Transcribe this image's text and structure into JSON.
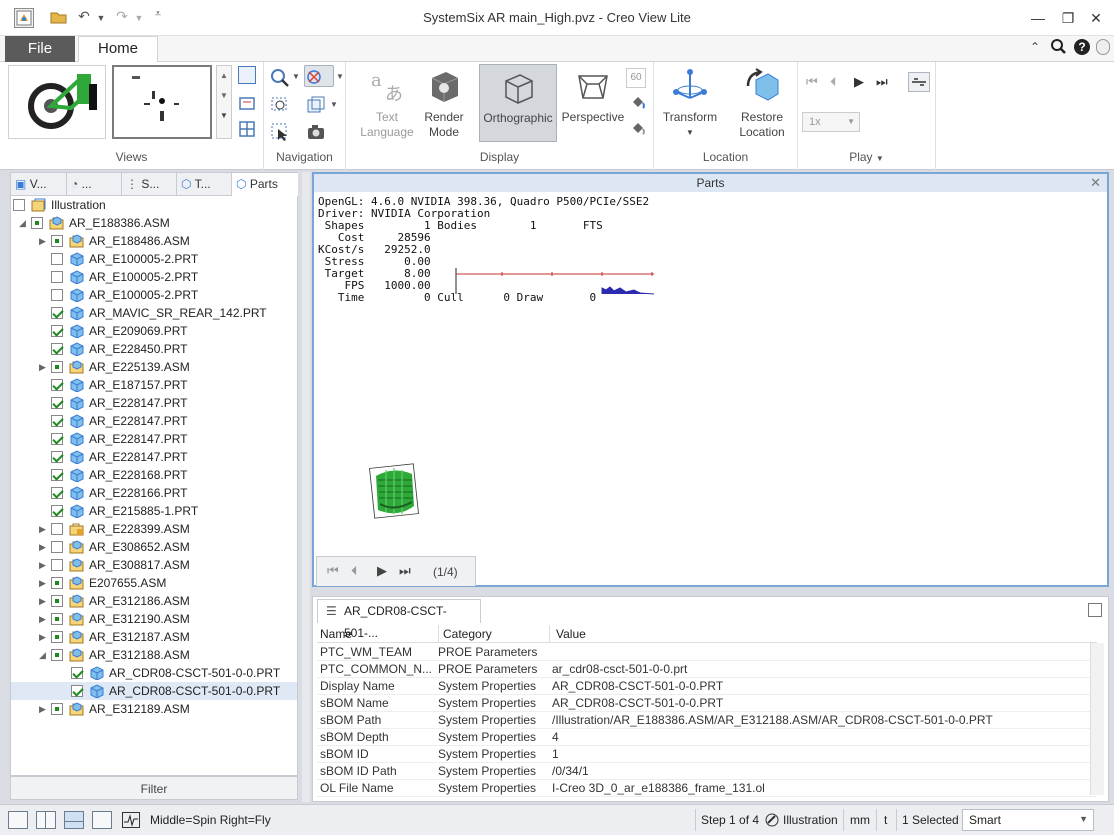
{
  "window": {
    "title": "SystemSix AR main_High.pvz - Creo View Lite"
  },
  "menu": {
    "file": "File",
    "home": "Home"
  },
  "ribbon": {
    "groups": {
      "views": "Views",
      "navigation": "Navigation",
      "display": "Display",
      "location": "Location",
      "play": "Play"
    },
    "text_language": [
      "Text",
      "Language"
    ],
    "render_mode": [
      "Render",
      "Mode"
    ],
    "orthographic": "Orthographic",
    "perspective": "Perspective",
    "fps_box": "60",
    "transform": "Transform",
    "restore_location": [
      "Restore",
      "Location"
    ],
    "speed": "1x"
  },
  "left_tabs": [
    "V...",
    "...",
    "S...",
    "T...",
    "Parts"
  ],
  "tree": [
    {
      "label": "Illustration",
      "level": 0,
      "exp": "",
      "chk": "",
      "icon": "illustration"
    },
    {
      "label": "AR_E188386.ASM",
      "level": 0,
      "exp": "open",
      "chk": "part",
      "icon": "asm"
    },
    {
      "label": "AR_E188486.ASM",
      "level": 1,
      "exp": "closed",
      "chk": "part",
      "icon": "asm"
    },
    {
      "label": "AR_E100005-2.PRT",
      "level": 1,
      "exp": "",
      "chk": "off",
      "icon": "prt"
    },
    {
      "label": "AR_E100005-2.PRT",
      "level": 1,
      "exp": "",
      "chk": "off",
      "icon": "prt"
    },
    {
      "label": "AR_E100005-2.PRT",
      "level": 1,
      "exp": "",
      "chk": "off",
      "icon": "prt"
    },
    {
      "label": "AR_MAVIC_SR_REAR_142.PRT",
      "level": 1,
      "exp": "",
      "chk": "on",
      "icon": "prt"
    },
    {
      "label": "AR_E209069.PRT",
      "level": 1,
      "exp": "",
      "chk": "on",
      "icon": "prt"
    },
    {
      "label": "AR_E228450.PRT",
      "level": 1,
      "exp": "",
      "chk": "on",
      "icon": "prt"
    },
    {
      "label": "AR_E225139.ASM",
      "level": 1,
      "exp": "closed",
      "chk": "part",
      "icon": "asm"
    },
    {
      "label": "AR_E187157.PRT",
      "level": 1,
      "exp": "",
      "chk": "on",
      "icon": "prt"
    },
    {
      "label": "AR_E228147.PRT",
      "level": 1,
      "exp": "",
      "chk": "on",
      "icon": "prt"
    },
    {
      "label": "AR_E228147.PRT",
      "level": 1,
      "exp": "",
      "chk": "on",
      "icon": "prt"
    },
    {
      "label": "AR_E228147.PRT",
      "level": 1,
      "exp": "",
      "chk": "on",
      "icon": "prt"
    },
    {
      "label": "AR_E228147.PRT",
      "level": 1,
      "exp": "",
      "chk": "on",
      "icon": "prt"
    },
    {
      "label": "AR_E228168.PRT",
      "level": 1,
      "exp": "",
      "chk": "on",
      "icon": "prt"
    },
    {
      "label": "AR_E228166.PRT",
      "level": 1,
      "exp": "",
      "chk": "on",
      "icon": "prt"
    },
    {
      "label": "AR_E215885-1.PRT",
      "level": 1,
      "exp": "",
      "chk": "on",
      "icon": "prt"
    },
    {
      "label": "AR_E228399.ASM",
      "level": 1,
      "exp": "closed",
      "chk": "off",
      "icon": "asmlock"
    },
    {
      "label": "AR_E308652.ASM",
      "level": 1,
      "exp": "closed",
      "chk": "off",
      "icon": "asm"
    },
    {
      "label": "AR_E308817.ASM",
      "level": 1,
      "exp": "closed",
      "chk": "off",
      "icon": "asm"
    },
    {
      "label": "E207655.ASM",
      "level": 1,
      "exp": "closed",
      "chk": "part",
      "icon": "asm"
    },
    {
      "label": "AR_E312186.ASM",
      "level": 1,
      "exp": "closed",
      "chk": "part",
      "icon": "asm"
    },
    {
      "label": "AR_E312190.ASM",
      "level": 1,
      "exp": "closed",
      "chk": "part",
      "icon": "asm"
    },
    {
      "label": "AR_E312187.ASM",
      "level": 1,
      "exp": "closed",
      "chk": "part",
      "icon": "asm"
    },
    {
      "label": "AR_E312188.ASM",
      "level": 1,
      "exp": "open",
      "chk": "part",
      "icon": "asm"
    },
    {
      "label": "AR_CDR08-CSCT-501-0-0.PRT",
      "level": 2,
      "exp": "",
      "chk": "on",
      "icon": "prt"
    },
    {
      "label": "AR_CDR08-CSCT-501-0-0.PRT",
      "level": 2,
      "exp": "",
      "chk": "on",
      "icon": "prt",
      "selected": true
    },
    {
      "label": "AR_E312189.ASM",
      "level": 1,
      "exp": "closed",
      "chk": "part",
      "icon": "asm"
    }
  ],
  "filter": "Filter",
  "parts_panel": {
    "title": "Parts",
    "stats": "OpenGL: 4.6.0 NVIDIA 398.36, Quadro P500/PCIe/SSE2\nDriver: NVIDIA Corporation\n Shapes         1 Bodies        1       FTS\n   Cost     28596\nKCost/s   29252.0\n Stress      0.00\n Target      8.00\n    FPS   1000.00\n   Time         0 Cull      0 Draw       0",
    "step_counter": "(1/4)"
  },
  "properties": {
    "tab": "AR_CDR08-CSCT-501-...",
    "columns": [
      "Name",
      "Category",
      "Value"
    ],
    "rows": [
      [
        "PTC_WM_TEAM",
        "PROE Parameters",
        ""
      ],
      [
        "PTC_COMMON_N...",
        "PROE Parameters",
        "ar_cdr08-csct-501-0-0.prt"
      ],
      [
        "Display Name",
        "System Properties",
        "AR_CDR08-CSCT-501-0-0.PRT"
      ],
      [
        "sBOM Name",
        "System Properties",
        "AR_CDR08-CSCT-501-0-0.PRT"
      ],
      [
        "sBOM Path",
        "System Properties",
        "/Illustration/AR_E188386.ASM/AR_E312188.ASM/AR_CDR08-CSCT-501-0-0.PRT"
      ],
      [
        "sBOM Depth",
        "System Properties",
        "4"
      ],
      [
        "sBOM ID",
        "System Properties",
        "1"
      ],
      [
        "sBOM ID Path",
        "System Properties",
        "/0/34/1"
      ],
      [
        "OL File Name",
        "System Properties",
        "I-Creo 3D_0_ar_e188386_frame_131.ol"
      ]
    ]
  },
  "status": {
    "mouse": "Middle=Spin  Right=Fly",
    "step": "Step 1 of 4",
    "illustration": "Illustration",
    "units": "mm",
    "t": "t",
    "selected": "1 Selected",
    "mode": "Smart"
  },
  "colors": {
    "accent": "#7aa6d6",
    "highlight": "#ffff00",
    "part_green": "#2fa83a"
  }
}
